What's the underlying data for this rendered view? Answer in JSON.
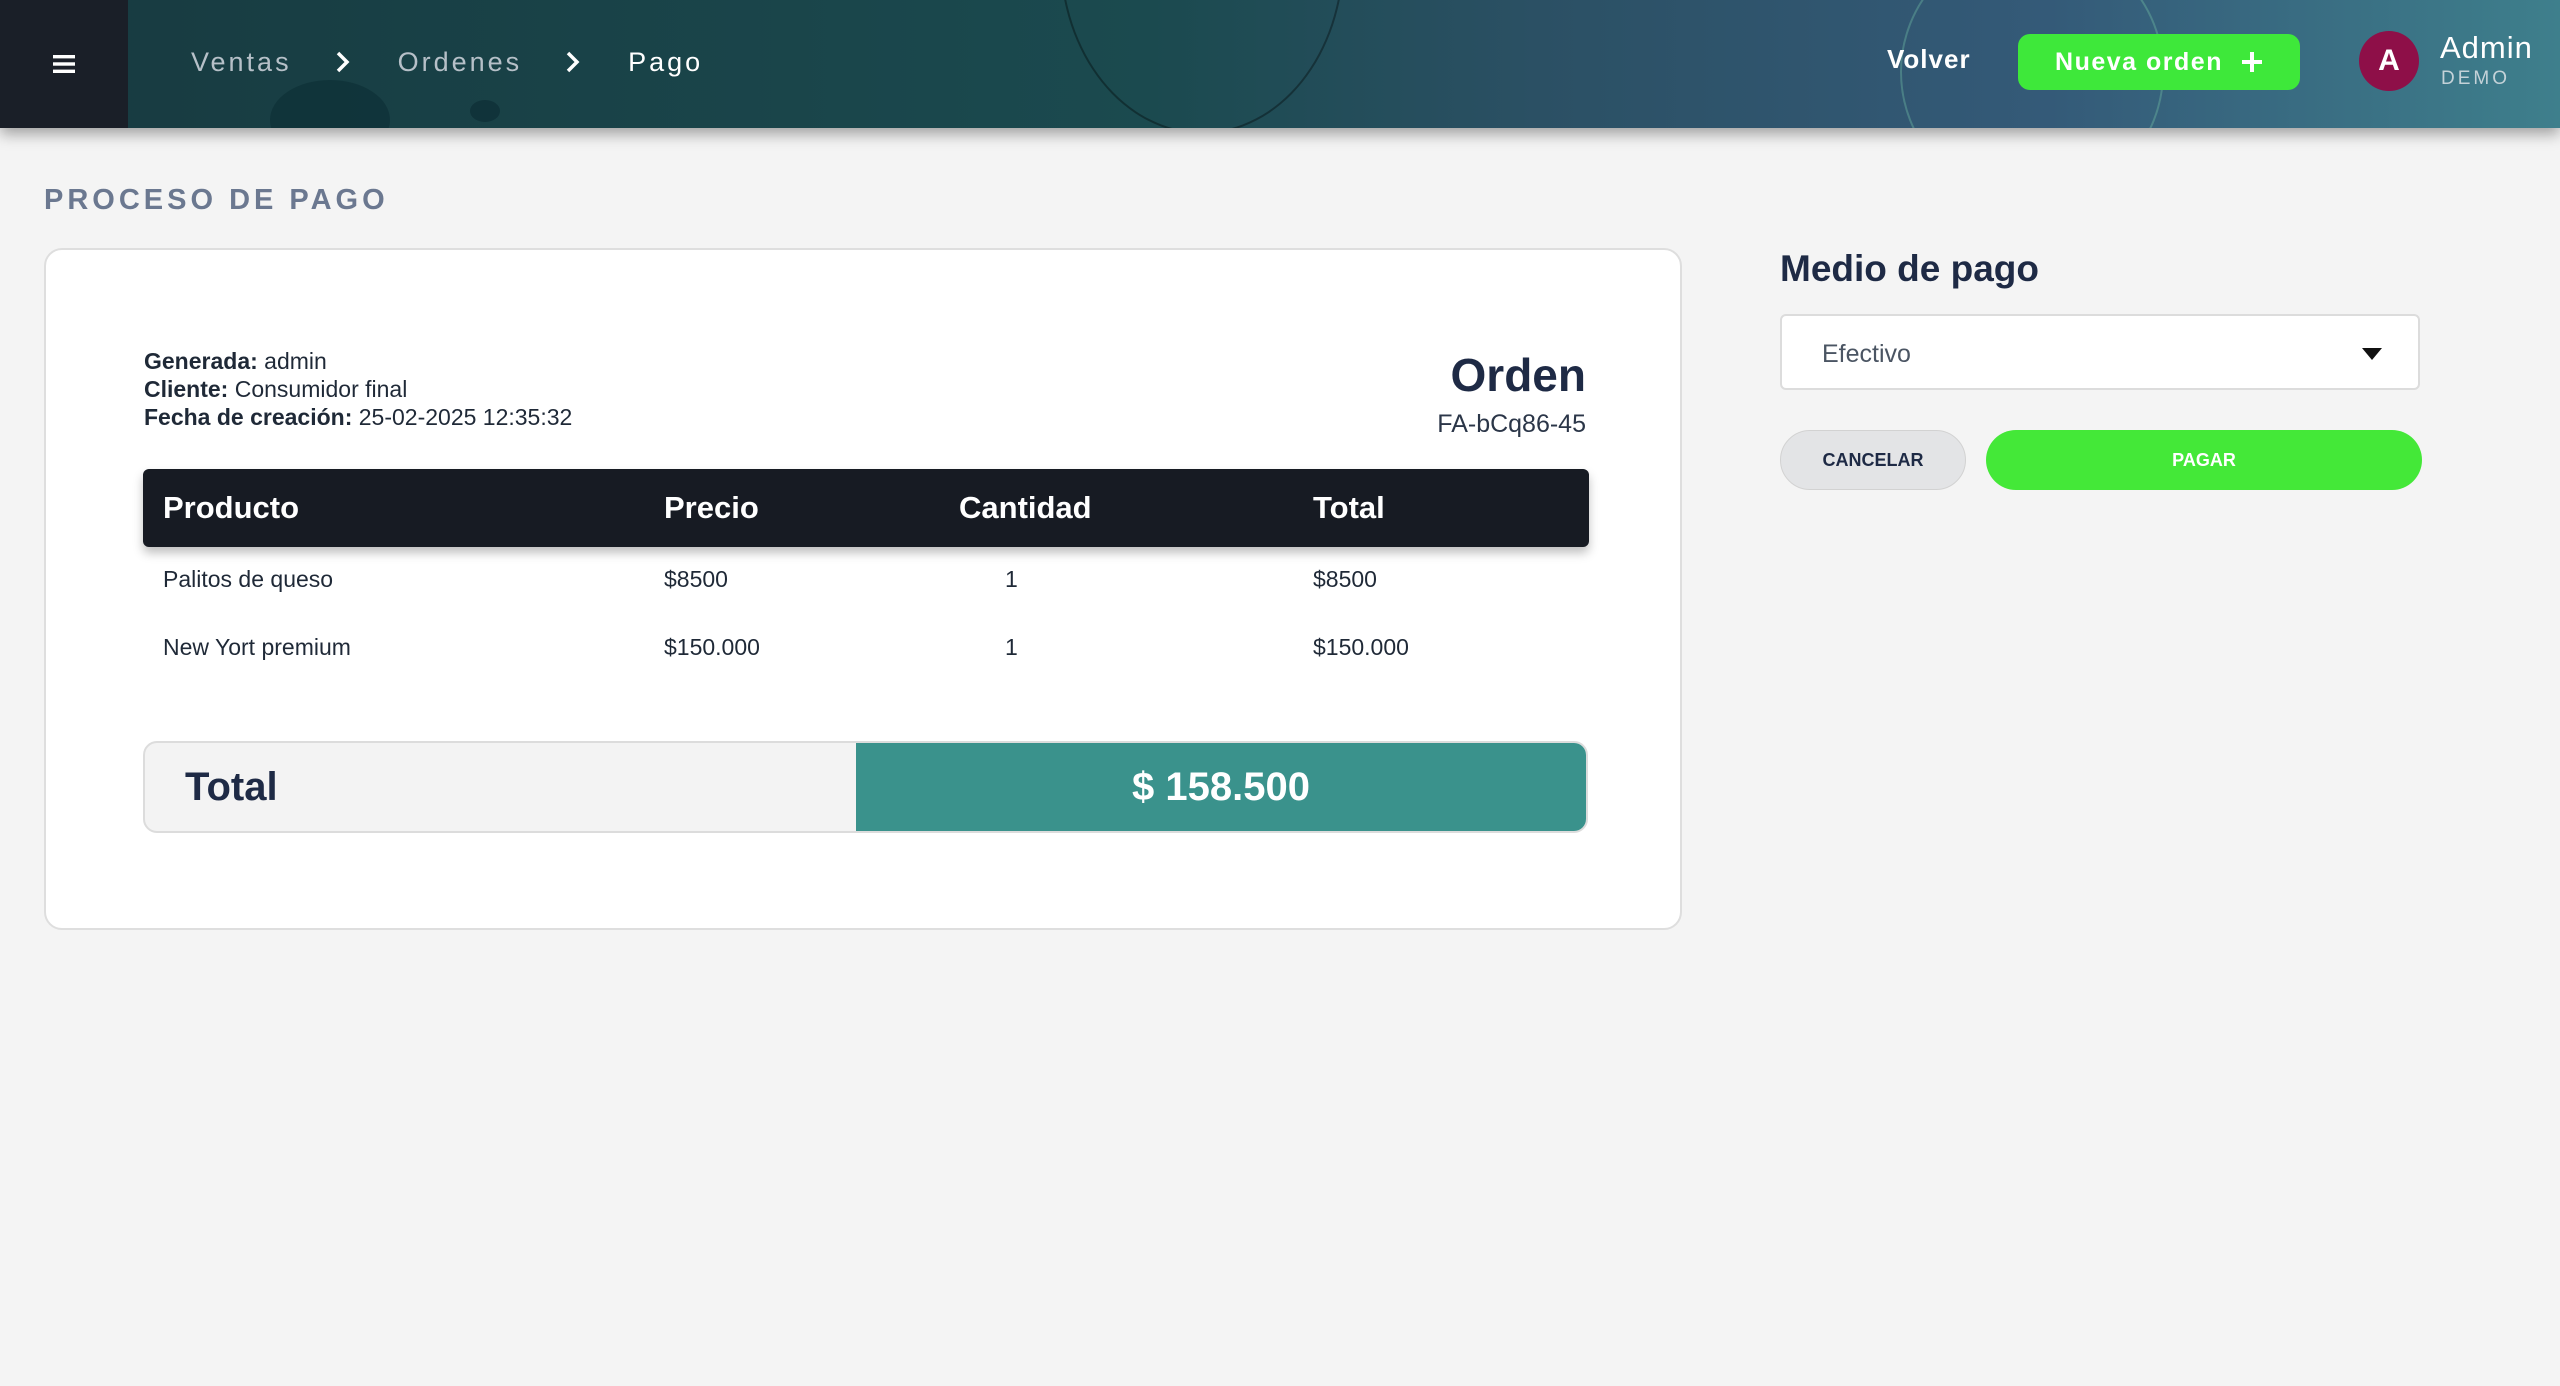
{
  "breadcrumb": {
    "items": [
      "Ventas",
      "Ordenes",
      "Pago"
    ]
  },
  "header": {
    "back_label": "Volver",
    "new_order_label": "Nueva orden",
    "user_initial": "A",
    "user_name": "Admin",
    "user_role": "DEMO"
  },
  "page": {
    "title": "PROCESO DE PAGO"
  },
  "order": {
    "generated_label": "Generada:",
    "generated_value": "admin",
    "client_label": "Cliente:",
    "client_value": "Consumidor final",
    "created_label": "Fecha de creación:",
    "created_value": "25-02-2025 12:35:32",
    "title": "Orden",
    "code": "FA-bCq86-45"
  },
  "table": {
    "headers": [
      "Producto",
      "Precio",
      "Cantidad",
      "Total"
    ],
    "rows": [
      [
        "Palitos de queso",
        "$8500",
        "1",
        "$8500"
      ],
      [
        "New Yort premium",
        "$150.000",
        "1",
        "$150.000"
      ]
    ]
  },
  "totals": {
    "label": "Total",
    "value": "$ 158.500"
  },
  "payment": {
    "title": "Medio de pago",
    "selected": "Efectivo",
    "cancel_label": "CANCELAR",
    "pay_label": "PAGAR"
  },
  "icons": {
    "menu": "menu-icon",
    "breadcrumb_separator": "chevron-right-icon",
    "new_order": "plus-icon",
    "select": "caret-down-icon"
  },
  "colors": {
    "accent_green": "#3ee83a",
    "total_teal": "#3a928c",
    "avatar": "#8e0f48",
    "table_header": "#171b23"
  }
}
